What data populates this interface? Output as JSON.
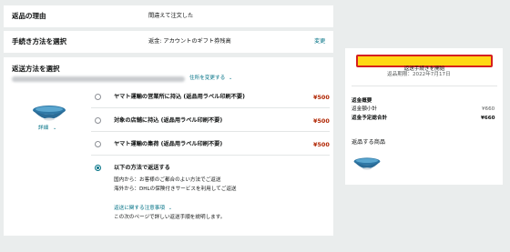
{
  "reason": {
    "heading": "返品の理由",
    "value": "間違えて注文した"
  },
  "procedure": {
    "heading": "手続き方法を選択",
    "value": "返金: アカウントのギフト券残高",
    "change_link": "変更"
  },
  "shipping": {
    "heading": "返送方法を選択",
    "address_link": "住所を変更する",
    "item_details_link": "詳細",
    "options": [
      {
        "label": "ヤマト運輸の営業所に持込 (返品用ラベル印刷不要)",
        "price": "¥500",
        "selected": false
      },
      {
        "label": "対象の店舗に持込 (返品用ラベル印刷不要)",
        "price": "¥500",
        "selected": false
      },
      {
        "label": "ヤマト運輸の集荷 (返品用ラベル印刷不要)",
        "price": "¥500",
        "selected": false
      },
      {
        "label": "以下の方法で返送する",
        "price": "",
        "selected": true
      }
    ],
    "self_ship": {
      "domestic": "国内から：お客様のご都合のよい方法でご返送",
      "overseas": "海外から：DHLの保険付きサービスを利用してご返送",
      "notes_link": "返送に関する注意事項",
      "notes_desc": "この次のページで詳しい返送手順を説明します。"
    }
  },
  "summary": {
    "start_button": "返送手続きを開始",
    "deadline": "返品期限：2022年7月17日",
    "refund_heading": "返金概要",
    "subtotal_label": "返金額小計",
    "subtotal_value": "¥660",
    "total_label": "返金予定総合計",
    "total_value": "¥660",
    "items_heading": "返品する商品"
  },
  "colors": {
    "button_bg": "#ffd814",
    "button_border": "#d51f1f",
    "price": "#b12704",
    "link": "#007185"
  },
  "icons": {
    "dropdown": "chevron-down-icon",
    "product": "blue-bowl-image"
  }
}
